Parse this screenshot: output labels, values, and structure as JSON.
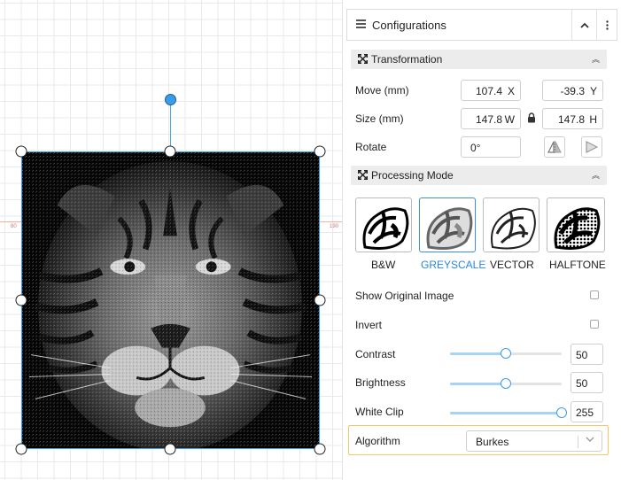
{
  "canvas": {
    "ruler_left": "80",
    "ruler_right": "190"
  },
  "panel": {
    "title": "Configurations",
    "menu_icon": "hamburger-icon",
    "collapse_icon": "chevron-up-icon",
    "more_icon": "kebab-icon"
  },
  "transformation": {
    "title": "Transformation",
    "icon": "transform-icon",
    "move_label": "Move (mm)",
    "move_x": "107.4",
    "move_x_axis": "X",
    "move_y": "-39.3",
    "move_y_axis": "Y",
    "size_label": "Size (mm)",
    "size_w": "147.8",
    "size_w_axis": "W",
    "size_h": "147.8",
    "size_h_axis": "H",
    "lock_icon": "lock-icon",
    "rotate_label": "Rotate",
    "rotate_value": "0°",
    "flip_h_icon": "flip-horizontal-icon",
    "flip_v_icon": "flip-vertical-icon"
  },
  "processing": {
    "title": "Processing Mode",
    "icon": "transform-icon",
    "modes": [
      {
        "label": "B&W"
      },
      {
        "label": "GREYSCALE"
      },
      {
        "label": "VECTOR"
      },
      {
        "label": "HALFTONE"
      }
    ],
    "selected_mode": "GREYSCALE"
  },
  "options": {
    "show_original_label": "Show Original Image",
    "show_original_checked": false,
    "invert_label": "Invert",
    "invert_checked": false,
    "contrast_label": "Contrast",
    "contrast_value": "50",
    "brightness_label": "Brightness",
    "brightness_value": "50",
    "white_clip_label": "White Clip",
    "white_clip_value": "255",
    "algorithm_label": "Algorithm",
    "algorithm_value": "Burkes"
  },
  "colors": {
    "accent": "#3b9ce8",
    "highlight": "#f2c868"
  }
}
